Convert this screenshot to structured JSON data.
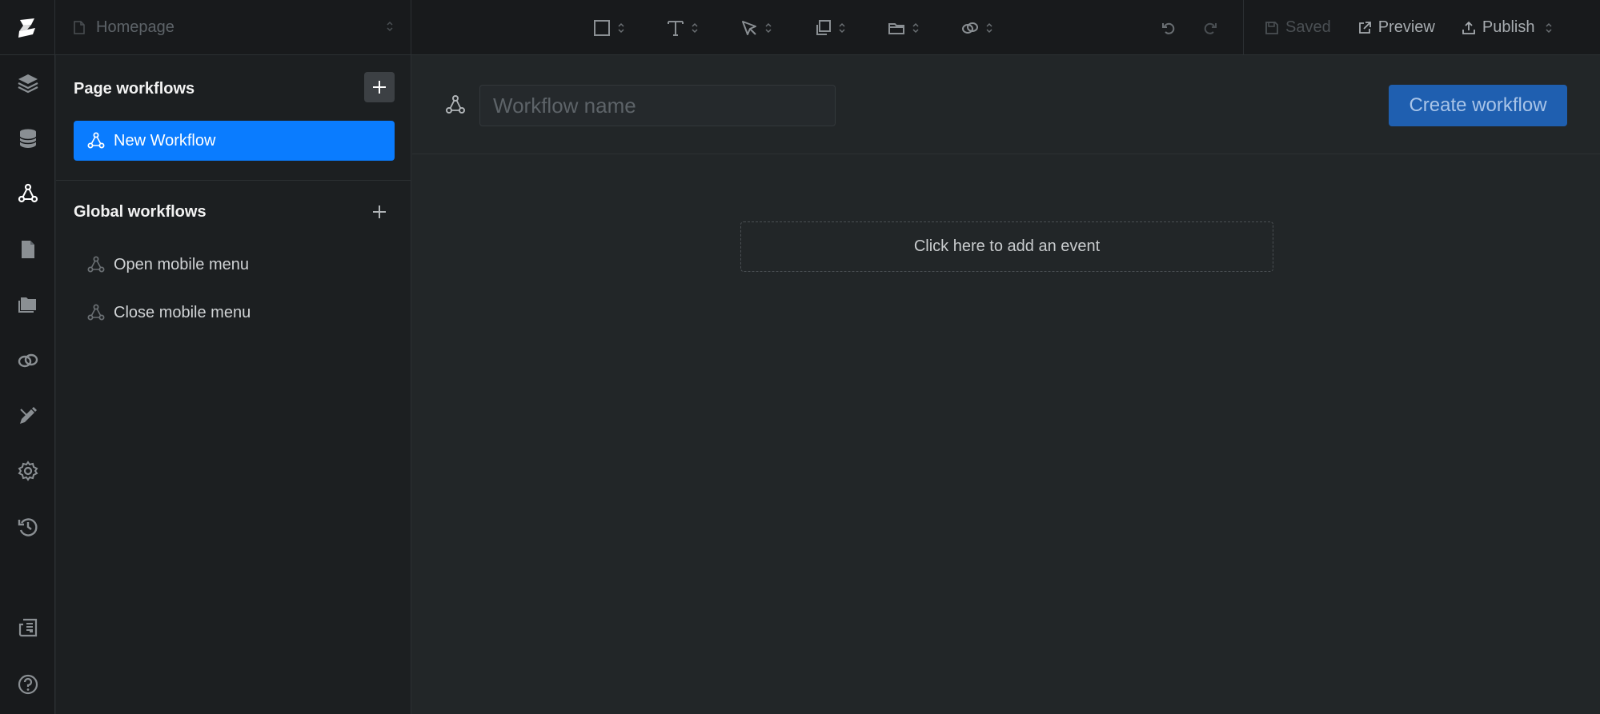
{
  "topbar": {
    "page_name": "Homepage",
    "actions": {
      "saved": "Saved",
      "preview": "Preview",
      "publish": "Publish"
    }
  },
  "sidebar": {
    "page_workflows": {
      "title": "Page workflows",
      "items": [
        {
          "label": "New Workflow",
          "active": true
        }
      ]
    },
    "global_workflows": {
      "title": "Global workflows",
      "items": [
        {
          "label": "Open mobile menu"
        },
        {
          "label": "Close mobile menu"
        }
      ]
    }
  },
  "main": {
    "workflow_name": {
      "value": "",
      "placeholder": "Workflow name"
    },
    "create_button": "Create workflow",
    "add_event": "Click here to add an event"
  },
  "colors": {
    "accent": "#0a7cff",
    "create_button": "#1f5fb0",
    "background": "#222628",
    "sidebar": "#1c1f21",
    "rail": "#181a1c"
  },
  "icons": {
    "rail": [
      "layers-icon",
      "database-icon",
      "workflow-icon",
      "document-icon",
      "folder-icon",
      "link-icon",
      "design-icon",
      "settings-icon",
      "history-icon",
      "news-icon",
      "help-icon"
    ],
    "tools": [
      "square-icon",
      "text-icon",
      "pointer-icon",
      "copy-icon",
      "folder-outline-icon",
      "link-icon"
    ]
  }
}
